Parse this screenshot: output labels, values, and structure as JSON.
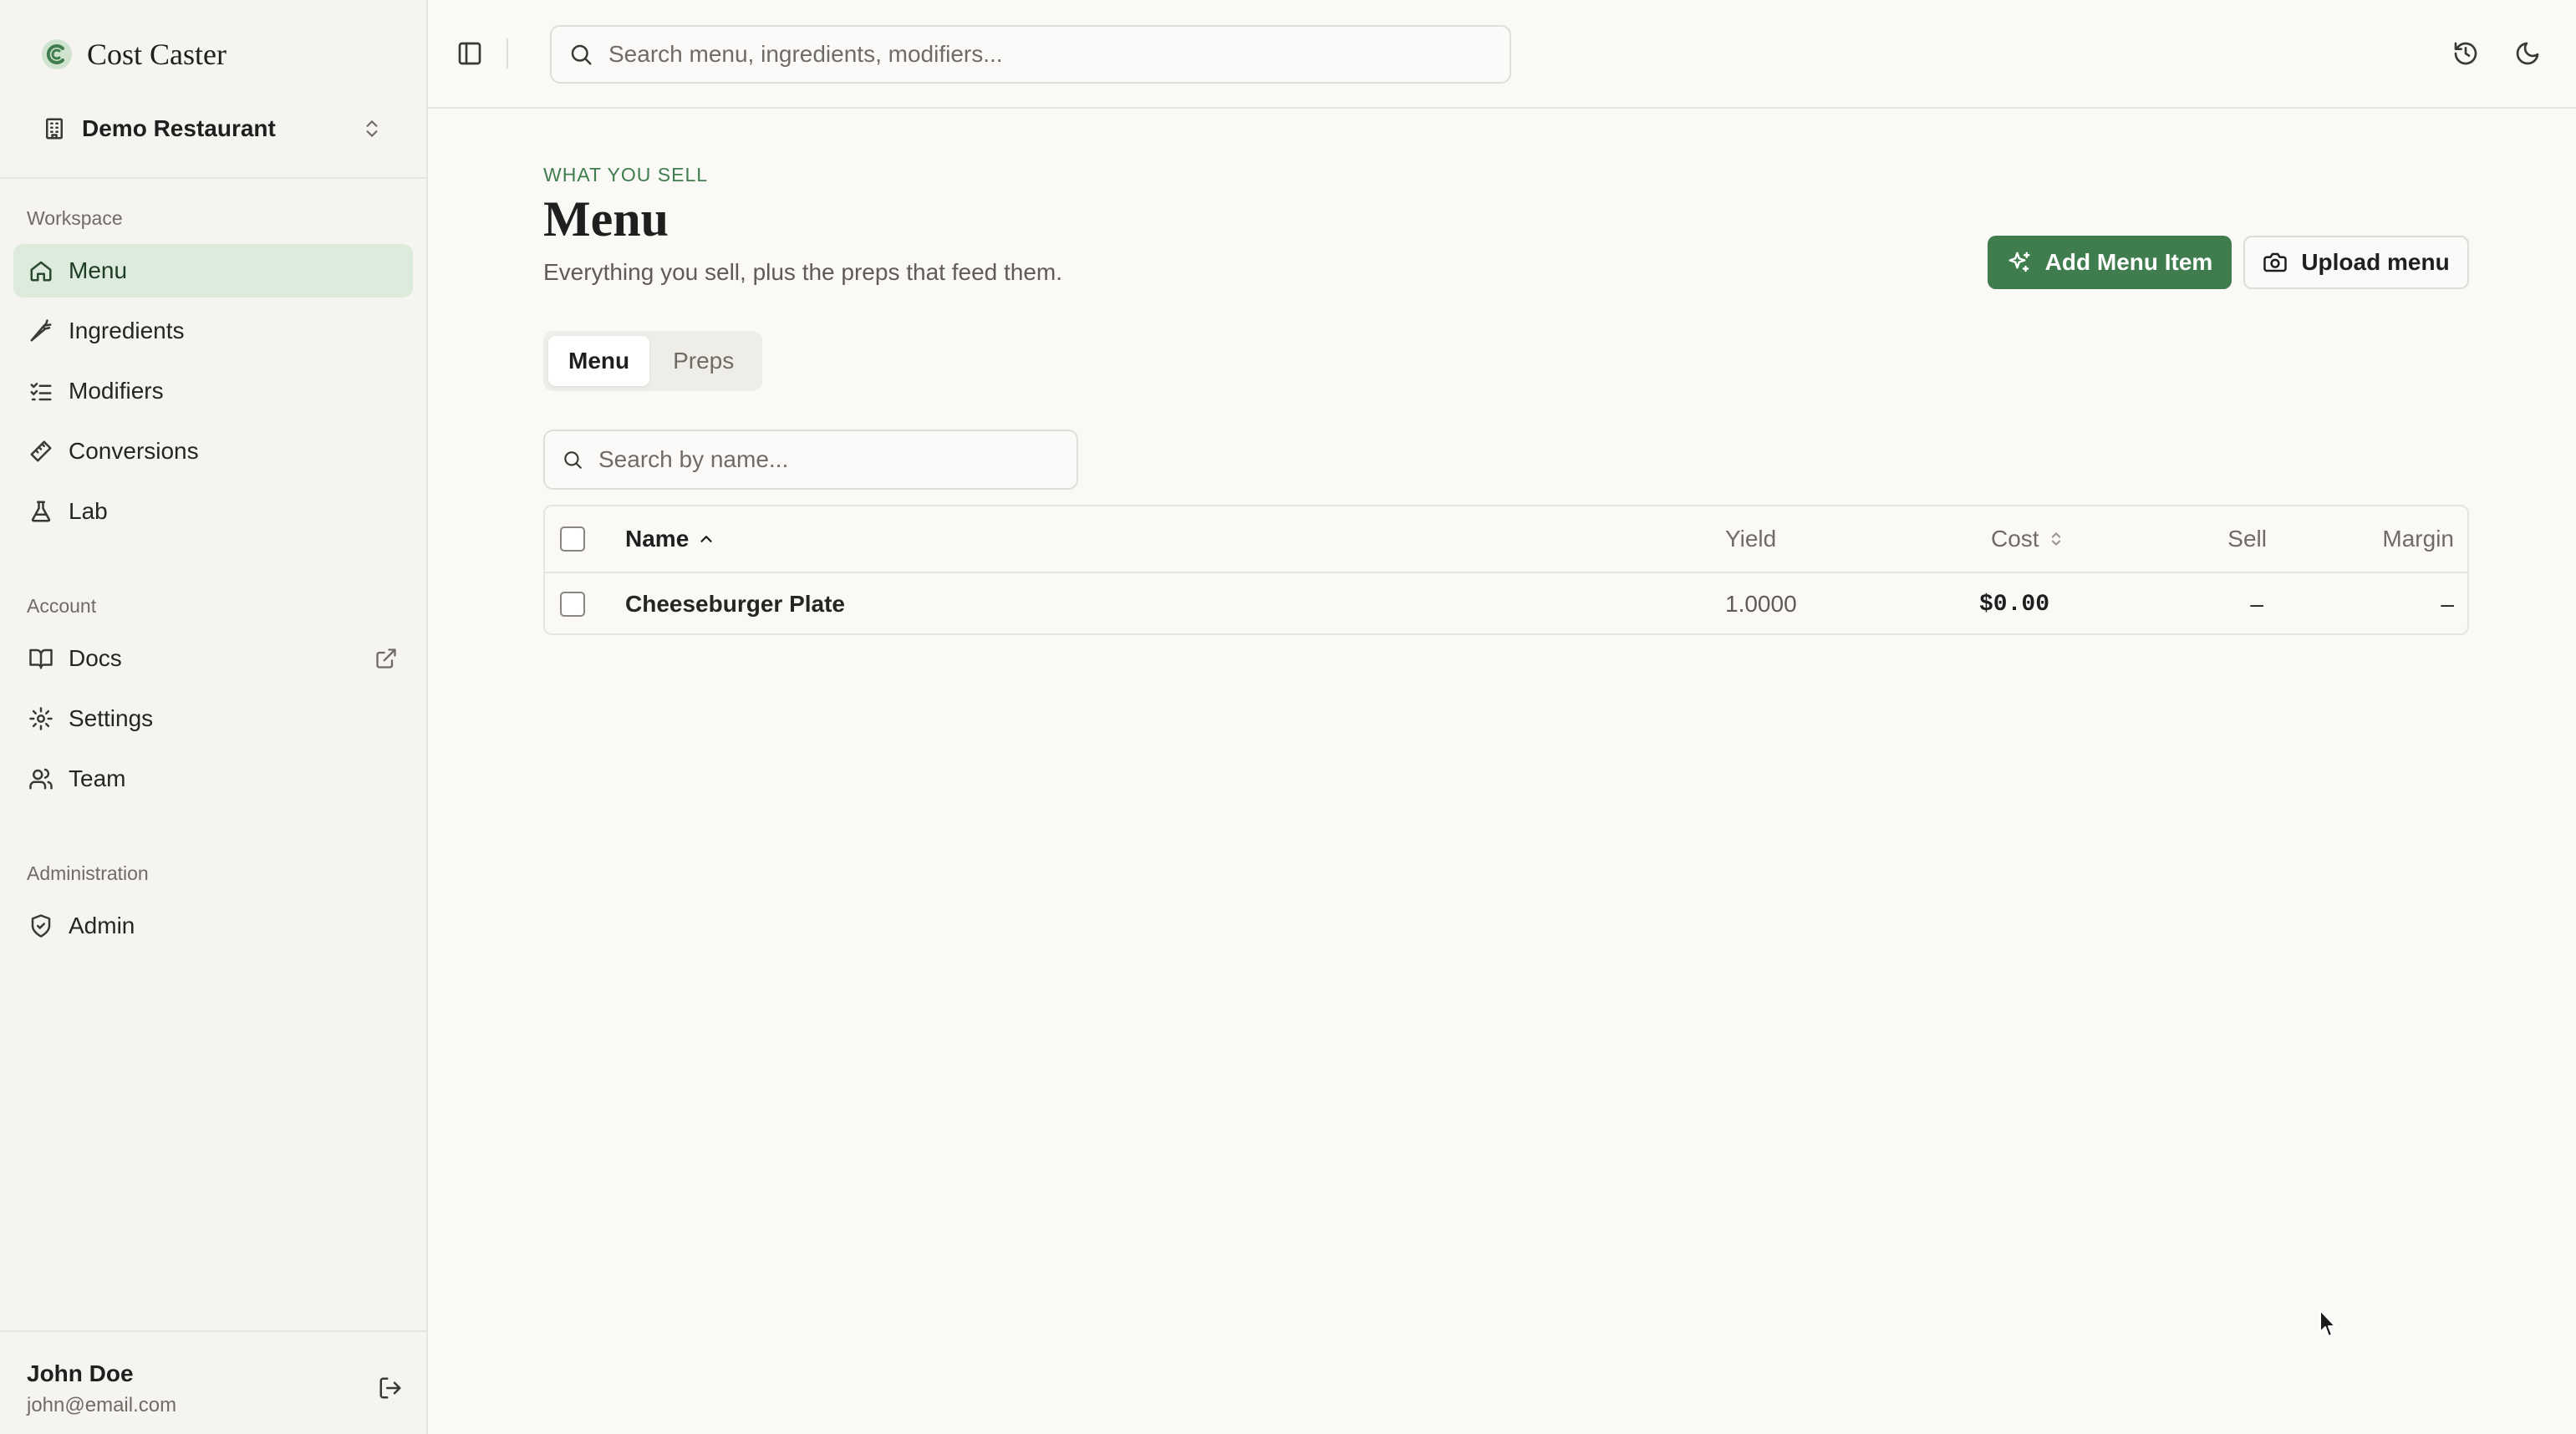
{
  "brand": {
    "name": "Cost Caster",
    "logo_icon": "cost-caster-logo-icon",
    "accent": "#3f7d4e"
  },
  "workspace": {
    "name": "Demo Restaurant"
  },
  "sidebar": {
    "sections": [
      {
        "label": "Workspace",
        "items": [
          {
            "label": "Menu",
            "icon": "home-icon",
            "active": true
          },
          {
            "label": "Ingredients",
            "icon": "carrot-icon"
          },
          {
            "label": "Modifiers",
            "icon": "list-checks-icon"
          },
          {
            "label": "Conversions",
            "icon": "ruler-icon"
          },
          {
            "label": "Lab",
            "icon": "flask-icon"
          }
        ]
      },
      {
        "label": "Account",
        "items": [
          {
            "label": "Docs",
            "icon": "book-icon",
            "external": true
          },
          {
            "label": "Settings",
            "icon": "gear-icon"
          },
          {
            "label": "Team",
            "icon": "users-icon"
          }
        ]
      },
      {
        "label": "Administration",
        "items": [
          {
            "label": "Admin",
            "icon": "shield-check-icon"
          }
        ]
      }
    ]
  },
  "user": {
    "name": "John Doe",
    "email": "john@email.com"
  },
  "topbar": {
    "search_placeholder": "Search menu, ingredients, modifiers..."
  },
  "page": {
    "eyebrow": "WHAT YOU SELL",
    "title": "Menu",
    "subtitle": "Everything you sell, plus the preps that feed them."
  },
  "actions": {
    "add_label": "Add Menu Item",
    "upload_label": "Upload menu"
  },
  "tabs": [
    {
      "label": "Menu",
      "active": true
    },
    {
      "label": "Preps",
      "active": false
    }
  ],
  "table": {
    "search_placeholder": "Search by name...",
    "columns": {
      "name": "Name",
      "yield": "Yield",
      "cost": "Cost",
      "sell": "Sell",
      "margin": "Margin"
    },
    "rows": [
      {
        "name": "Cheeseburger Plate",
        "yield": "1.0000",
        "cost": "$0.00",
        "sell": "–",
        "margin": "–"
      }
    ]
  }
}
